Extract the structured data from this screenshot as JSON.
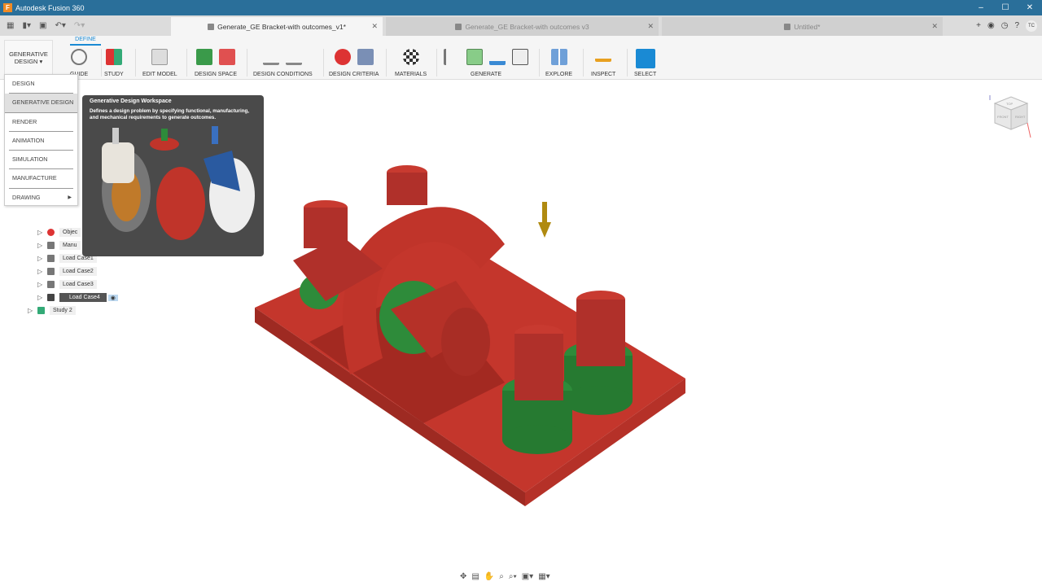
{
  "app": {
    "title": "Autodesk Fusion 360",
    "logo": "F"
  },
  "window_controls": [
    "–",
    "☐",
    "✕"
  ],
  "tabs": [
    {
      "label": "Generate_GE Bracket-with outcomes_v1*",
      "active": true
    },
    {
      "label": "Generate_GE Bracket-with outcomes v3",
      "active": false
    },
    {
      "label": "Untitled*",
      "active": false
    }
  ],
  "user_initials": "TC",
  "toolbar": {
    "workspace": "GENERATIVE DESIGN",
    "tab": "DEFINE",
    "groups": [
      "GUIDE",
      "STUDY",
      "EDIT MODEL",
      "DESIGN SPACE",
      "DESIGN CONDITIONS",
      "DESIGN CRITERIA",
      "MATERIALS",
      "GENERATE",
      "EXPLORE",
      "INSPECT",
      "SELECT"
    ]
  },
  "workspace_menu": [
    "DESIGN",
    "GENERATIVE DESIGN",
    "RENDER",
    "ANIMATION",
    "SIMULATION",
    "MANUFACTURE",
    "DRAWING"
  ],
  "tooltip": {
    "title": "Generative Design Workspace",
    "body": "Defines a design problem by specifying functional, manufacturing, and mechanical requirements to generate outcomes."
  },
  "browser": {
    "items": [
      "Objec",
      "Manu",
      "Load Case1",
      "Load Case2",
      "Load Case3",
      "Load Case4",
      "Study 2"
    ]
  },
  "viewcube": {
    "top": "TOP",
    "front": "FRONT",
    "right": "RIGHT"
  },
  "colors": {
    "titlebar": "#2a6f9a",
    "accent": "#1a8ad4",
    "part_red": "#c0342a",
    "part_green": "#2e8b3a"
  }
}
